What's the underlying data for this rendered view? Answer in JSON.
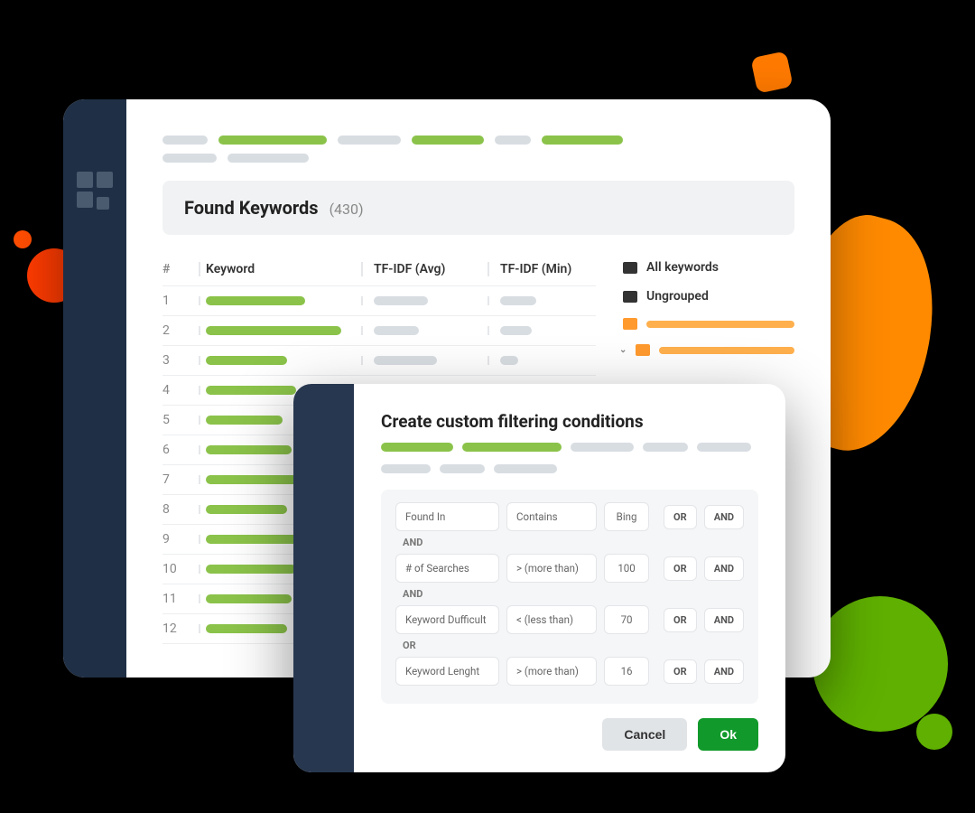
{
  "section": {
    "title": "Found Keywords",
    "count": "(430)"
  },
  "columns": {
    "num": "#",
    "keyword": "Keyword",
    "avg": "TF-IDF (Avg)",
    "min": "TF-IDF (Min)"
  },
  "rows": [
    {
      "n": "1",
      "kw": 110,
      "avg": 60,
      "min": 40
    },
    {
      "n": "2",
      "kw": 150,
      "avg": 50,
      "min": 35
    },
    {
      "n": "3",
      "kw": 90,
      "avg": 70,
      "min": 20
    },
    {
      "n": "4",
      "kw": 100,
      "avg": 0,
      "min": 0
    },
    {
      "n": "5",
      "kw": 85,
      "avg": 0,
      "min": 0
    },
    {
      "n": "6",
      "kw": 95,
      "avg": 0,
      "min": 0
    },
    {
      "n": "7",
      "kw": 120,
      "avg": 0,
      "min": 0
    },
    {
      "n": "8",
      "kw": 90,
      "avg": 0,
      "min": 0
    },
    {
      "n": "9",
      "kw": 105,
      "avg": 0,
      "min": 0
    },
    {
      "n": "10",
      "kw": 100,
      "avg": 0,
      "min": 0
    },
    {
      "n": "11",
      "kw": 95,
      "avg": 0,
      "min": 0
    },
    {
      "n": "12",
      "kw": 90,
      "avg": 0,
      "min": 0
    }
  ],
  "folders": {
    "all": "All keywords",
    "ungrouped": "Ungrouped"
  },
  "modal": {
    "title": "Create custom filtering conditions",
    "conditions": [
      {
        "field": "Found In",
        "op": "Contains",
        "val": "Bing",
        "join_after": "AND"
      },
      {
        "field": "# of Searches",
        "op": "> (more than)",
        "val": "100",
        "join_after": "AND"
      },
      {
        "field": "Keyword Dufficult",
        "op": "< (less than)",
        "val": "70",
        "join_after": "OR"
      },
      {
        "field": "Keyword Lenght",
        "op": "> (more than)",
        "val": "16",
        "join_after": ""
      }
    ],
    "or_label": "OR",
    "and_label": "AND",
    "cancel": "Cancel",
    "ok": "Ok"
  }
}
